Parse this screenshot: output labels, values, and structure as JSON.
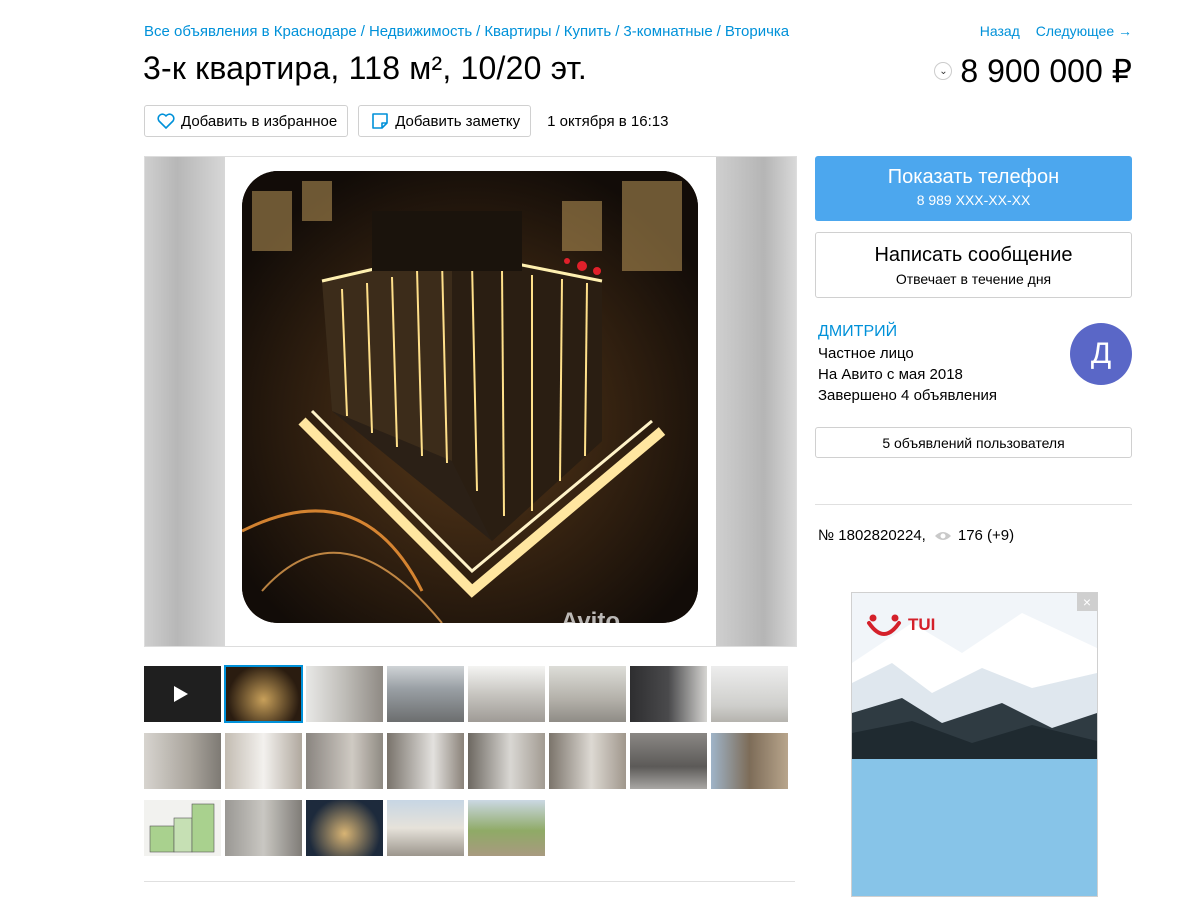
{
  "breadcrumbs": {
    "items": [
      "Все объявления в Краснодаре",
      "Недвижимость",
      "Квартиры",
      "Купить",
      "3-комнатные",
      "Вторичка"
    ],
    "separator": "/"
  },
  "nav": {
    "back": "Назад",
    "next": "Следующее →"
  },
  "listing": {
    "title": "3-к квартира, 118 м², 10/20 эт.",
    "price": "8 900 000 ₽",
    "price_toggle": "⌄",
    "date": "1 октября в 16:13",
    "add_favorite": "Добавить в избранное",
    "add_note": "Добавить заметку",
    "watermark": "Avito"
  },
  "gallery": {
    "active_index": 1,
    "thumb_count": 21
  },
  "sidebar": {
    "phone_button": "Показать телефон",
    "phone_number": "8 989 XXX-XX-XX",
    "message_button": "Написать сообщение",
    "message_sub": "Отвечает в течение дня",
    "seller_name": "ДМИТРИЙ",
    "seller_type": "Частное лицо",
    "seller_since": "На Авито с мая 2018",
    "seller_completed": "Завершено 4 объявления",
    "avatar_letter": "Д",
    "user_ads_button": "5 объявлений пользователя",
    "listing_number": "№ 1802820224,",
    "views": "176 (+9)"
  },
  "ad": {
    "brand": "TUI",
    "close": "×"
  },
  "colors": {
    "link": "#0091d9",
    "primary": "#4ca7ee",
    "avatar": "#5a67c7",
    "brand_red": "#d4202a"
  }
}
